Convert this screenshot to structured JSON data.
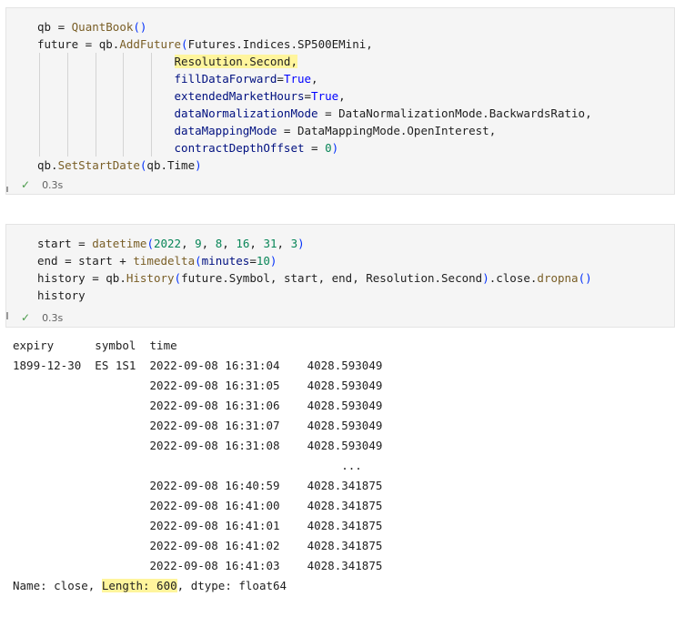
{
  "cells": [
    {
      "status": {
        "time": "0.3s"
      },
      "code": {
        "l1": {
          "var": "qb",
          "op": " = ",
          "fn": "QuantBook",
          "paren": "()"
        },
        "l2": {
          "var": "future",
          "op": " = ",
          "obj": "qb.",
          "fn": "AddFuture",
          "open": "(",
          "arg": "Futures.Indices.SP500EMini,"
        },
        "l3": {
          "arg": "Resolution.Second",
          "comma": ","
        },
        "l4": {
          "param": "fillDataForward",
          "eq": "=",
          "val": "True",
          "comma": ","
        },
        "l5": {
          "param": "extendedMarketHours",
          "eq": "=",
          "val": "True",
          "comma": ","
        },
        "l6": {
          "param": "dataNormalizationMode",
          "eq": " = ",
          "val": "DataNormalizationMode.BackwardsRatio,"
        },
        "l7": {
          "param": "dataMappingMode",
          "eq": " = ",
          "val": "DataMappingMode.OpenInterest,"
        },
        "l8": {
          "param": "contractDepthOffset",
          "eq": " = ",
          "num": "0",
          "close": ")"
        },
        "l9": {
          "obj": "qb.",
          "fn": "SetStartDate",
          "open": "(",
          "arg": "qb.Time",
          "close": ")"
        }
      }
    },
    {
      "status": {
        "time": "0.3s"
      },
      "code": {
        "l1": {
          "var": "start",
          "op": " = ",
          "fn": "datetime",
          "open": "(",
          "n1": "2022",
          "c1": ", ",
          "n2": "9",
          "c2": ", ",
          "n3": "8",
          "c3": ", ",
          "n4": "16",
          "c4": ", ",
          "n5": "31",
          "c5": ", ",
          "n6": "3",
          "close": ")"
        },
        "l2": {
          "var": "end",
          "op": " = start + ",
          "fn": "timedelta",
          "open": "(",
          "param": "minutes",
          "eq": "=",
          "num": "10",
          "close": ")"
        },
        "l3": {
          "var": "history",
          "op": " = qb.",
          "fn": "History",
          "open": "(",
          "arg": "future.Symbol, start, end, Resolution.Second",
          "close": ")",
          "tail": ".close.",
          "fn2": "dropna",
          "paren2": "()"
        },
        "l4": {
          "text": "history"
        }
      }
    }
  ],
  "output": {
    "header": "expiry      symbol  time",
    "rows": [
      "1899-12-30  ES 1S1  2022-09-08 16:31:04    4028.593049",
      "                    2022-09-08 16:31:05    4028.593049",
      "                    2022-09-08 16:31:06    4028.593049",
      "                    2022-09-08 16:31:07    4028.593049",
      "                    2022-09-08 16:31:08    4028.593049",
      "                                                ...",
      "                    2022-09-08 16:40:59    4028.341875",
      "                    2022-09-08 16:41:00    4028.341875",
      "                    2022-09-08 16:41:01    4028.341875",
      "                    2022-09-08 16:41:02    4028.341875",
      "                    2022-09-08 16:41:03    4028.341875"
    ],
    "footer": {
      "pre": "Name: close, ",
      "highlight": "Length: 600",
      "post": ", dtype: float64"
    }
  }
}
